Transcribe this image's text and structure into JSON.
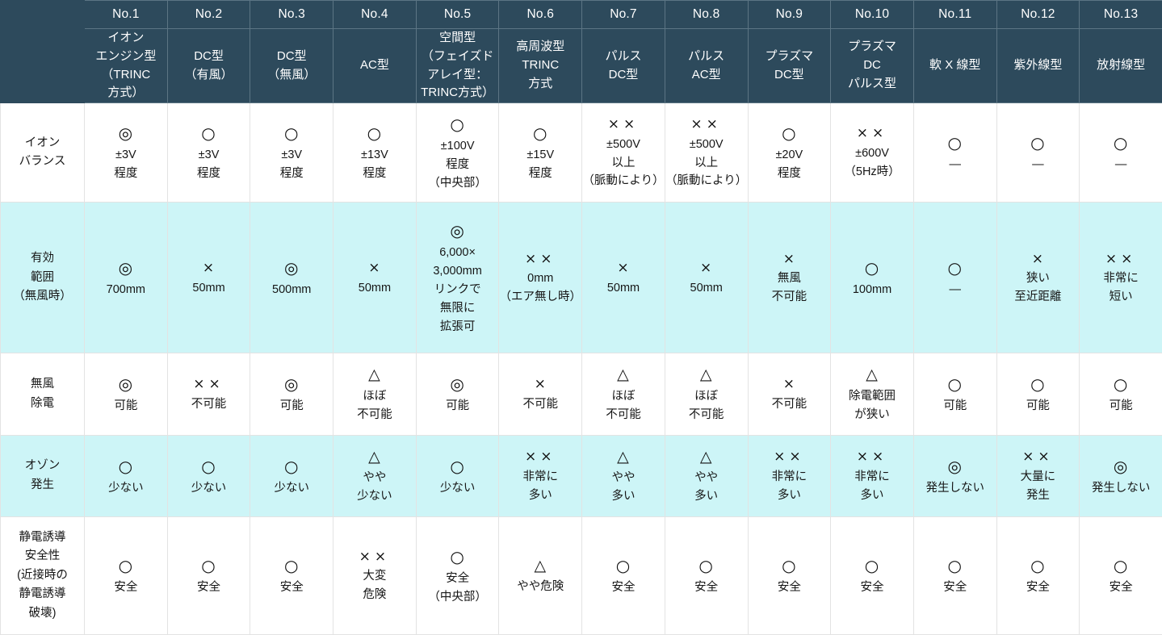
{
  "table": {
    "colors": {
      "header_bg": "#2d4a5c",
      "header_text": "#ffffff",
      "tint_row_bg": "#cdf5f7",
      "plain_row_bg": "#ffffff",
      "grid_line": "#e3e3e3",
      "body_text": "#161616"
    },
    "corner_label": "",
    "columns": [
      {
        "no": "No.1",
        "name_lines": [
          "イオン",
          "エンジン型",
          "（TRINC",
          "方式）"
        ]
      },
      {
        "no": "No.2",
        "name_lines": [
          "DC型",
          "（有風）"
        ]
      },
      {
        "no": "No.3",
        "name_lines": [
          "DC型",
          "（無風）"
        ]
      },
      {
        "no": "No.4",
        "name_lines": [
          "AC型"
        ]
      },
      {
        "no": "No.5",
        "name_lines": [
          "空間型",
          "（フェイズド",
          "アレイ型：",
          "TRINC方式）"
        ]
      },
      {
        "no": "No.6",
        "name_lines": [
          "高周波型",
          "TRINC",
          "方式"
        ]
      },
      {
        "no": "No.7",
        "name_lines": [
          "パルス",
          "DC型"
        ]
      },
      {
        "no": "No.8",
        "name_lines": [
          "パルス",
          "AC型"
        ]
      },
      {
        "no": "No.9",
        "name_lines": [
          "プラズマ",
          "DC型"
        ]
      },
      {
        "no": "No.10",
        "name_lines": [
          "プラズマ",
          "DC",
          "パルス型"
        ]
      },
      {
        "no": "No.11",
        "name_lines": [
          "軟 X 線型"
        ]
      },
      {
        "no": "No.12",
        "name_lines": [
          "紫外線型"
        ]
      },
      {
        "no": "No.13",
        "name_lines": [
          "放射線型"
        ]
      }
    ],
    "rows": [
      {
        "id": "ion-balance",
        "tint": false,
        "label_lines": [
          "イオン",
          "バランス"
        ],
        "cells": [
          {
            "symbol": "◎",
            "sym_kind": "dbl",
            "text_lines": [
              "±3V",
              "程度"
            ]
          },
          {
            "symbol": "○",
            "sym_kind": "circ",
            "text_lines": [
              "±3V",
              "程度"
            ]
          },
          {
            "symbol": "○",
            "sym_kind": "circ",
            "text_lines": [
              "±3V",
              "程度"
            ]
          },
          {
            "symbol": "○",
            "sym_kind": "circ",
            "text_lines": [
              "±13V",
              "程度"
            ]
          },
          {
            "symbol": "○",
            "sym_kind": "circ",
            "text_lines": [
              "±100V",
              "程度",
              "（中央部）"
            ]
          },
          {
            "symbol": "○",
            "sym_kind": "circ",
            "text_lines": [
              "±15V",
              "程度"
            ]
          },
          {
            "symbol": "××",
            "sym_kind": "x2",
            "text_lines": [
              "±500V",
              "以上",
              "（脈動により）"
            ]
          },
          {
            "symbol": "××",
            "sym_kind": "x2",
            "text_lines": [
              "±500V",
              "以上",
              "（脈動により）"
            ]
          },
          {
            "symbol": "○",
            "sym_kind": "circ",
            "text_lines": [
              "±20V",
              "程度"
            ]
          },
          {
            "symbol": "××",
            "sym_kind": "x2",
            "text_lines": [
              "±600V",
              "（5Hz時）"
            ]
          },
          {
            "symbol": "○",
            "sym_kind": "circ",
            "text_lines": [
              "—"
            ]
          },
          {
            "symbol": "○",
            "sym_kind": "circ",
            "text_lines": [
              "—"
            ]
          },
          {
            "symbol": "○",
            "sym_kind": "circ",
            "text_lines": [
              "—"
            ]
          }
        ]
      },
      {
        "id": "effective-range",
        "tint": true,
        "label_lines": [
          "有効",
          "範囲",
          "（無風時）"
        ],
        "cells": [
          {
            "symbol": "◎",
            "sym_kind": "dbl",
            "text_lines": [
              "700mm"
            ]
          },
          {
            "symbol": "×",
            "sym_kind": "x1",
            "text_lines": [
              "50mm"
            ]
          },
          {
            "symbol": "◎",
            "sym_kind": "dbl",
            "text_lines": [
              "500mm"
            ]
          },
          {
            "symbol": "×",
            "sym_kind": "x1",
            "text_lines": [
              "50mm"
            ]
          },
          {
            "symbol": "◎",
            "sym_kind": "dbl",
            "text_lines": [
              "6,000×",
              "3,000mm",
              "リンクで",
              "無限に",
              "拡張可"
            ]
          },
          {
            "symbol": "××",
            "sym_kind": "x2",
            "text_lines": [
              "0mm",
              "（エア無し時）"
            ]
          },
          {
            "symbol": "×",
            "sym_kind": "x1",
            "text_lines": [
              "50mm"
            ]
          },
          {
            "symbol": "×",
            "sym_kind": "x1",
            "text_lines": [
              "50mm"
            ]
          },
          {
            "symbol": "×",
            "sym_kind": "x1",
            "text_lines": [
              "無風",
              "不可能"
            ]
          },
          {
            "symbol": "○",
            "sym_kind": "circ",
            "text_lines": [
              "100mm"
            ]
          },
          {
            "symbol": "○",
            "sym_kind": "circ",
            "text_lines": [
              "—"
            ]
          },
          {
            "symbol": "×",
            "sym_kind": "x1",
            "text_lines": [
              "狭い",
              "至近距離"
            ]
          },
          {
            "symbol": "××",
            "sym_kind": "x2",
            "text_lines": [
              "非常に",
              "短い"
            ]
          }
        ]
      },
      {
        "id": "windless-static-removal",
        "tint": false,
        "label_lines": [
          "無風",
          "除電"
        ],
        "cells": [
          {
            "symbol": "◎",
            "sym_kind": "dbl",
            "text_lines": [
              "可能"
            ]
          },
          {
            "symbol": "××",
            "sym_kind": "x2",
            "text_lines": [
              "不可能"
            ]
          },
          {
            "symbol": "◎",
            "sym_kind": "dbl",
            "text_lines": [
              "可能"
            ]
          },
          {
            "symbol": "△",
            "sym_kind": "tri",
            "text_lines": [
              "ほぼ",
              "不可能"
            ]
          },
          {
            "symbol": "◎",
            "sym_kind": "dbl",
            "text_lines": [
              "可能"
            ]
          },
          {
            "symbol": "×",
            "sym_kind": "x1",
            "text_lines": [
              "不可能"
            ]
          },
          {
            "symbol": "△",
            "sym_kind": "tri",
            "text_lines": [
              "ほぼ",
              "不可能"
            ]
          },
          {
            "symbol": "△",
            "sym_kind": "tri",
            "text_lines": [
              "ほぼ",
              "不可能"
            ]
          },
          {
            "symbol": "×",
            "sym_kind": "x1",
            "text_lines": [
              "不可能"
            ]
          },
          {
            "symbol": "△",
            "sym_kind": "tri",
            "text_lines": [
              "除電範囲",
              "が狭い"
            ]
          },
          {
            "symbol": "○",
            "sym_kind": "circ",
            "text_lines": [
              "可能"
            ]
          },
          {
            "symbol": "○",
            "sym_kind": "circ",
            "text_lines": [
              "可能"
            ]
          },
          {
            "symbol": "○",
            "sym_kind": "circ",
            "text_lines": [
              "可能"
            ]
          }
        ]
      },
      {
        "id": "ozone-generation",
        "tint": true,
        "label_lines": [
          "オゾン",
          "発生"
        ],
        "cells": [
          {
            "symbol": "○",
            "sym_kind": "circ",
            "text_lines": [
              "少ない"
            ]
          },
          {
            "symbol": "○",
            "sym_kind": "circ",
            "text_lines": [
              "少ない"
            ]
          },
          {
            "symbol": "○",
            "sym_kind": "circ",
            "text_lines": [
              "少ない"
            ]
          },
          {
            "symbol": "△",
            "sym_kind": "tri",
            "text_lines": [
              "やや",
              "少ない"
            ]
          },
          {
            "symbol": "○",
            "sym_kind": "circ",
            "text_lines": [
              "少ない"
            ]
          },
          {
            "symbol": "××",
            "sym_kind": "x2",
            "text_lines": [
              "非常に",
              "多い"
            ]
          },
          {
            "symbol": "△",
            "sym_kind": "tri",
            "text_lines": [
              "やや",
              "多い"
            ]
          },
          {
            "symbol": "△",
            "sym_kind": "tri",
            "text_lines": [
              "やや",
              "多い"
            ]
          },
          {
            "symbol": "××",
            "sym_kind": "x2",
            "text_lines": [
              "非常に",
              "多い"
            ]
          },
          {
            "symbol": "××",
            "sym_kind": "x2",
            "text_lines": [
              "非常に",
              "多い"
            ]
          },
          {
            "symbol": "◎",
            "sym_kind": "dbl",
            "text_lines": [
              "発生しない"
            ]
          },
          {
            "symbol": "××",
            "sym_kind": "x2",
            "text_lines": [
              "大量に",
              "発生"
            ]
          },
          {
            "symbol": "◎",
            "sym_kind": "dbl",
            "text_lines": [
              "発生しない"
            ]
          }
        ]
      },
      {
        "id": "electrostatic-induction-safety",
        "tint": false,
        "label_lines": [
          "静電誘導",
          "安全性",
          "(近接時の",
          "静電誘導",
          "破壊)"
        ],
        "cells": [
          {
            "symbol": "○",
            "sym_kind": "circ",
            "text_lines": [
              "安全"
            ]
          },
          {
            "symbol": "○",
            "sym_kind": "circ",
            "text_lines": [
              "安全"
            ]
          },
          {
            "symbol": "○",
            "sym_kind": "circ",
            "text_lines": [
              "安全"
            ]
          },
          {
            "symbol": "××",
            "sym_kind": "x2",
            "text_lines": [
              "大変",
              "危険"
            ]
          },
          {
            "symbol": "○",
            "sym_kind": "circ",
            "text_lines": [
              "安全",
              "（中央部）"
            ]
          },
          {
            "symbol": "△",
            "sym_kind": "tri",
            "text_lines": [
              "やや危険"
            ]
          },
          {
            "symbol": "○",
            "sym_kind": "circ",
            "text_lines": [
              "安全"
            ]
          },
          {
            "symbol": "○",
            "sym_kind": "circ",
            "text_lines": [
              "安全"
            ]
          },
          {
            "symbol": "○",
            "sym_kind": "circ",
            "text_lines": [
              "安全"
            ]
          },
          {
            "symbol": "○",
            "sym_kind": "circ",
            "text_lines": [
              "安全"
            ]
          },
          {
            "symbol": "○",
            "sym_kind": "circ",
            "text_lines": [
              "安全"
            ]
          },
          {
            "symbol": "○",
            "sym_kind": "circ",
            "text_lines": [
              "安全"
            ]
          },
          {
            "symbol": "○",
            "sym_kind": "circ",
            "text_lines": [
              "安全"
            ]
          }
        ]
      }
    ]
  }
}
